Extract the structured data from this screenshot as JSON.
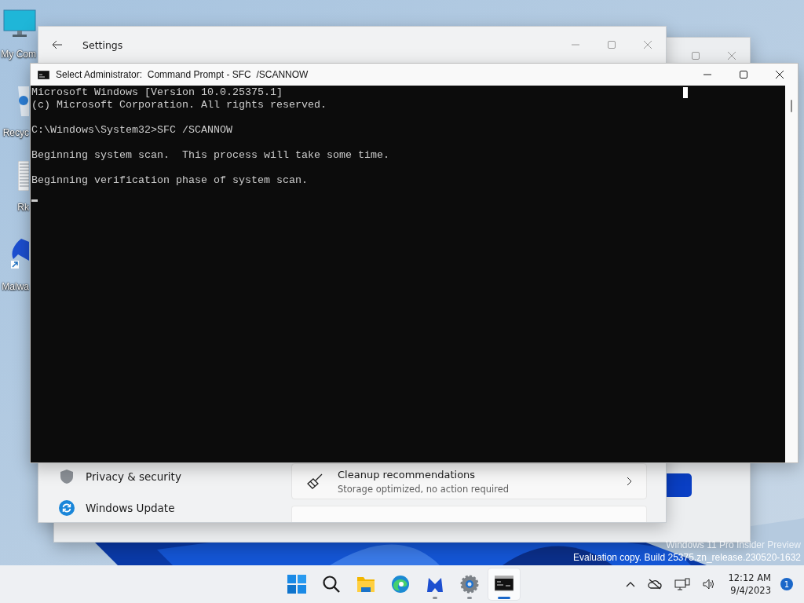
{
  "desktop": {
    "icons": [
      {
        "kind": "computer",
        "label": "My Com"
      },
      {
        "kind": "recycle",
        "label": "Recyc"
      },
      {
        "kind": "document",
        "label": "Rk"
      },
      {
        "kind": "malwarebytes",
        "label": "Malwa"
      }
    ]
  },
  "settings_window": {
    "title": "Settings",
    "nav_items": [
      {
        "kind": "shield",
        "label": "Privacy & security"
      },
      {
        "kind": "update",
        "label": "Windows Update"
      }
    ],
    "cards": [
      {
        "kind": "broom",
        "title": "Cleanup recommendations",
        "subtitle": "Storage optimized, no action required"
      }
    ]
  },
  "console_window": {
    "title": "Select Administrator:  Command Prompt - SFC  /SCANNOW",
    "paragraphs": [
      [
        "Microsoft Windows [Version 10.0.25375.1]",
        "(c) Microsoft Corporation. All rights reserved."
      ],
      [
        "C:\\Windows\\System32>SFC /SCANNOW"
      ],
      [
        "Beginning system scan.  This process will take some time."
      ],
      [
        "Beginning verification phase of system scan."
      ]
    ]
  },
  "watermark": [
    "Windows 11 Pro Insider Preview",
    "Evaluation copy. Build 25375.zn_release.230520-1632"
  ],
  "taskbar": {
    "apps": [
      {
        "kind": "start",
        "running": false,
        "selected": false
      },
      {
        "kind": "search",
        "running": false,
        "selected": false
      },
      {
        "kind": "explorer",
        "running": false,
        "selected": false
      },
      {
        "kind": "edge",
        "running": false,
        "selected": false
      },
      {
        "kind": "malwarebytes",
        "running": true,
        "selected": false
      },
      {
        "kind": "settings",
        "running": true,
        "selected": false
      },
      {
        "kind": "terminal",
        "running": true,
        "selected": true
      }
    ],
    "time": "12:12 AM",
    "date": "9/4/2023",
    "notifications": "1"
  }
}
